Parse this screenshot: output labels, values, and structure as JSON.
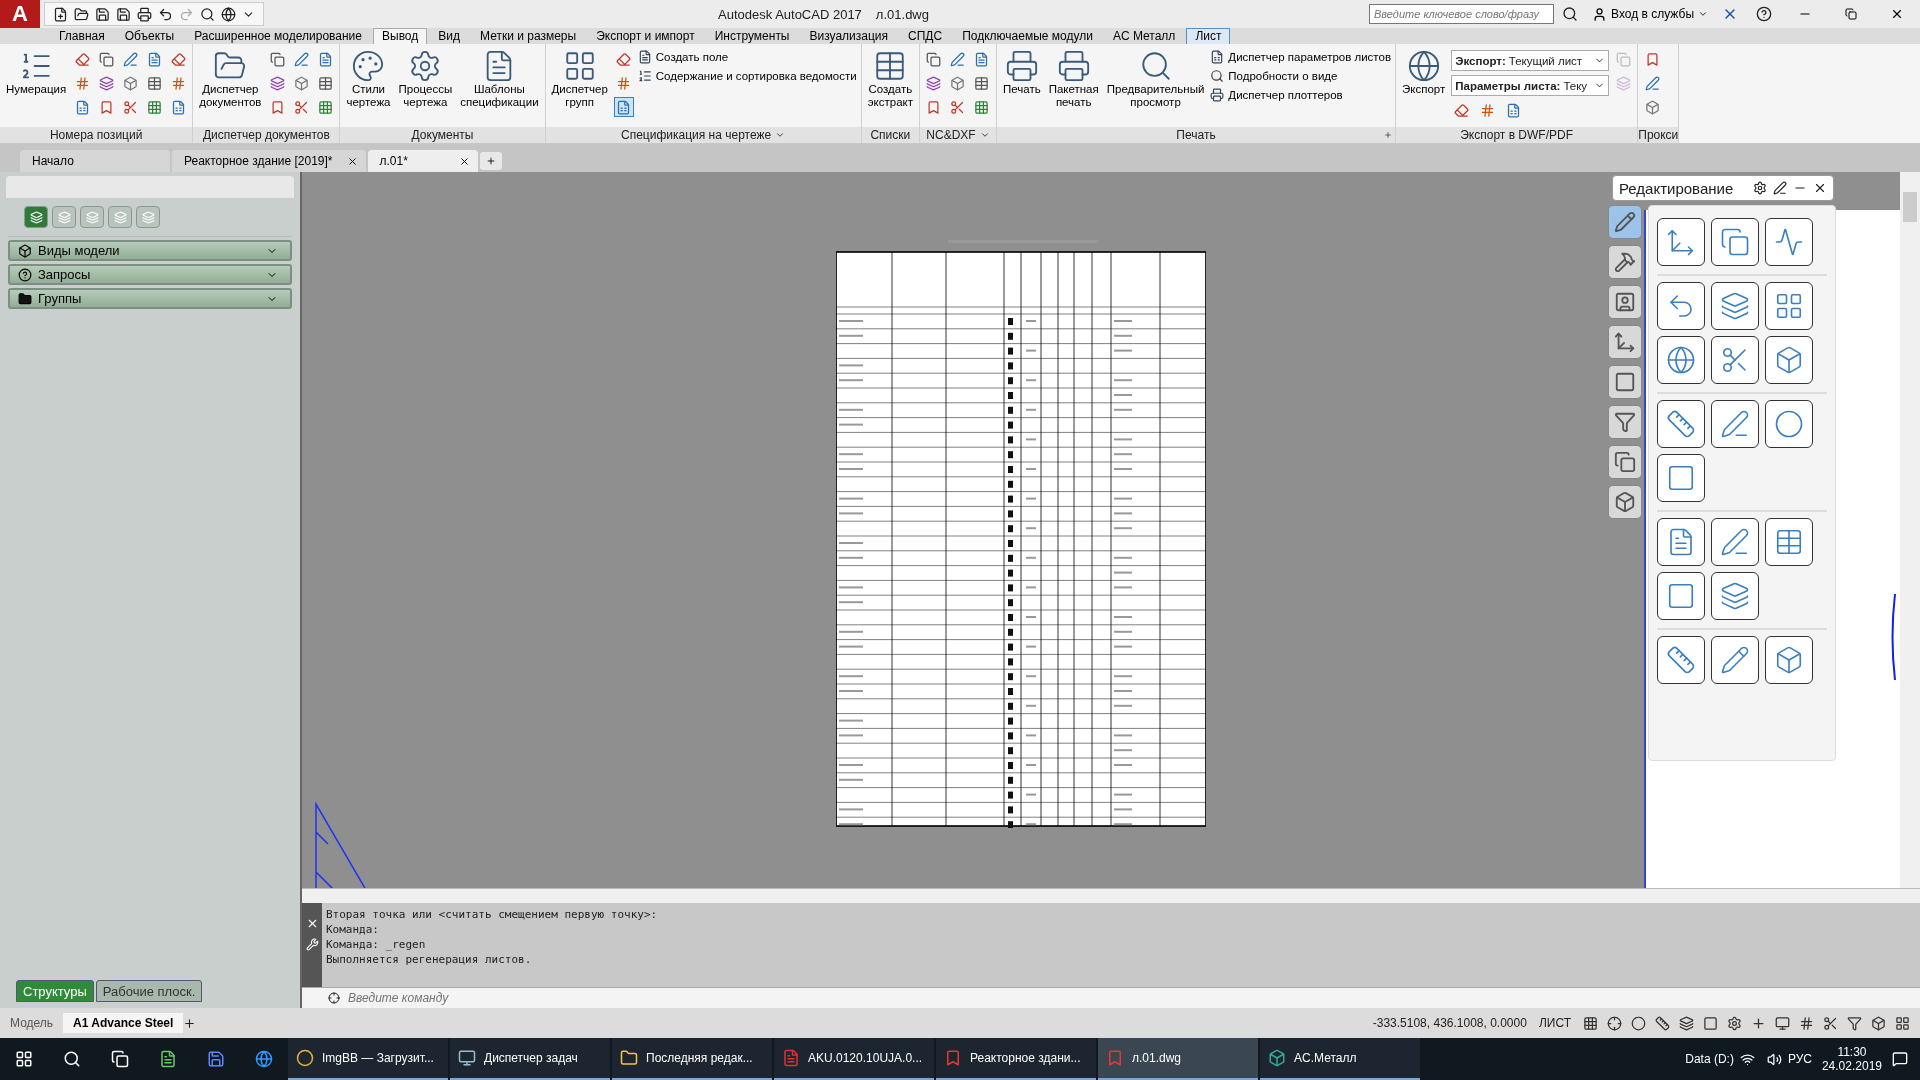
{
  "app_menu": {
    "letter": "A"
  },
  "window": {
    "title": "Autodesk AutoCAD 2017",
    "file": "л.01.dwg"
  },
  "search": {
    "placeholder": "Введите ключевое слово/фразу"
  },
  "sign_in": {
    "label": "Вход в службы"
  },
  "ribbon_tabs": [
    {
      "label": "Главная",
      "selected": false,
      "outlined": false
    },
    {
      "label": "Объекты",
      "selected": false,
      "outlined": false
    },
    {
      "label": "Расширенное моделирование",
      "selected": false,
      "outlined": false
    },
    {
      "label": "Вывод",
      "selected": true,
      "outlined": false
    },
    {
      "label": "Вид",
      "selected": false,
      "outlined": false
    },
    {
      "label": "Метки и размеры",
      "selected": false,
      "outlined": false
    },
    {
      "label": "Экспорт и импорт",
      "selected": false,
      "outlined": false
    },
    {
      "label": "Инструменты",
      "selected": false,
      "outlined": false
    },
    {
      "label": "Визуализация",
      "selected": false,
      "outlined": false
    },
    {
      "label": "СПДС",
      "selected": false,
      "outlined": false
    },
    {
      "label": "Подключаемые модули",
      "selected": false,
      "outlined": false
    },
    {
      "label": "AC Металл",
      "selected": false,
      "outlined": false
    },
    {
      "label": "Лист",
      "selected": false,
      "outlined": true
    }
  ],
  "ribbon_groups": [
    {
      "label": "Номера позиций",
      "has_menu": false,
      "launcher": false,
      "items": [
        {
          "kind": "large",
          "label": "Нумерация"
        },
        {
          "kind": "icon",
          "selected": false,
          "disabled": false
        },
        {
          "kind": "icon",
          "selected": false,
          "disabled": false
        },
        {
          "kind": "icon",
          "selected": false,
          "disabled": false
        },
        {
          "kind": "icon",
          "selected": false,
          "disabled": false
        },
        {
          "kind": "icon",
          "selected": false,
          "disabled": false
        },
        {
          "kind": "icon",
          "selected": false,
          "disabled": false
        },
        {
          "kind": "icon",
          "selected": false,
          "disabled": false
        },
        {
          "kind": "icon",
          "selected": false,
          "disabled": false
        },
        {
          "kind": "icon",
          "selected": false,
          "disabled": false
        },
        {
          "kind": "icon",
          "selected": false,
          "disabled": false
        },
        {
          "kind": "icon",
          "selected": false,
          "disabled": false
        },
        {
          "kind": "icon",
          "selected": false,
          "disabled": false
        },
        {
          "kind": "icon",
          "selected": false,
          "disabled": false
        },
        {
          "kind": "icon",
          "selected": false,
          "disabled": false
        },
        {
          "kind": "icon",
          "selected": false,
          "disabled": false
        }
      ]
    },
    {
      "label": "Диспетчер документов",
      "has_menu": false,
      "launcher": false,
      "items": [
        {
          "kind": "large",
          "label": "Диспетчер документов"
        },
        {
          "kind": "icon",
          "selected": false,
          "disabled": false
        },
        {
          "kind": "icon",
          "selected": false,
          "disabled": false
        },
        {
          "kind": "icon",
          "selected": false,
          "disabled": false
        },
        {
          "kind": "icon",
          "selected": false,
          "disabled": false
        },
        {
          "kind": "icon",
          "selected": false,
          "disabled": false
        },
        {
          "kind": "icon",
          "selected": false,
          "disabled": false
        },
        {
          "kind": "icon",
          "selected": false,
          "disabled": false
        },
        {
          "kind": "icon",
          "selected": false,
          "disabled": false
        },
        {
          "kind": "icon",
          "selected": false,
          "disabled": false
        }
      ]
    },
    {
      "label": "Документы",
      "has_menu": false,
      "launcher": false,
      "items": [
        {
          "kind": "large",
          "label": "Стили чертежа"
        },
        {
          "kind": "large",
          "label": "Процессы чертежа"
        },
        {
          "kind": "large",
          "label": "Шаблоны спецификации"
        }
      ]
    },
    {
      "label": "Спецификация на чертеже",
      "has_menu": true,
      "launcher": false,
      "items": [
        {
          "kind": "large",
          "label": "Диспетчер групп"
        },
        {
          "kind": "icon",
          "selected": false,
          "disabled": false
        },
        {
          "kind": "icon",
          "selected": false,
          "disabled": false
        },
        {
          "kind": "icon",
          "selected": true,
          "disabled": false
        },
        {
          "kind": "text",
          "label": "Создать поле"
        },
        {
          "kind": "text",
          "label": "Содержание и сортировка ведомости"
        }
      ]
    },
    {
      "label": "Списки",
      "has_menu": false,
      "launcher": false,
      "items": [
        {
          "kind": "large",
          "label": "Создать экстракт"
        }
      ]
    },
    {
      "label": "NC&DXF",
      "has_menu": true,
      "launcher": false,
      "items": [
        {
          "kind": "icon",
          "selected": false,
          "disabled": false
        },
        {
          "kind": "icon",
          "selected": false,
          "disabled": false
        },
        {
          "kind": "icon",
          "selected": false,
          "disabled": false
        },
        {
          "kind": "icon",
          "selected": false,
          "disabled": false
        },
        {
          "kind": "icon",
          "selected": false,
          "disabled": false
        },
        {
          "kind": "icon",
          "selected": false,
          "disabled": false
        },
        {
          "kind": "icon",
          "selected": false,
          "disabled": false
        },
        {
          "kind": "icon",
          "selected": false,
          "disabled": false
        },
        {
          "kind": "icon",
          "selected": false,
          "disabled": false
        }
      ]
    },
    {
      "label": "Печать",
      "has_menu": false,
      "launcher": true,
      "items": [
        {
          "kind": "large",
          "label": "Печать"
        },
        {
          "kind": "large",
          "label": "Пакетная печать"
        },
        {
          "kind": "large",
          "label": "Предварительный просмотр"
        },
        {
          "kind": "text",
          "label": "Диспетчер параметров листов"
        },
        {
          "kind": "text",
          "label": "Подробности о виде"
        },
        {
          "kind": "text",
          "label": "Диспетчер плоттеров"
        }
      ]
    },
    {
      "label": "Экспорт в DWF/PDF",
      "has_menu": false,
      "launcher": false,
      "items": [
        {
          "kind": "large",
          "label": "Экспорт"
        },
        {
          "kind": "dropdown",
          "label": "Экспорт:",
          "value": "Текущий лист"
        },
        {
          "kind": "dropdown",
          "label": "Параметры листа:",
          "value": "Теку"
        },
        {
          "kind": "icon",
          "selected": false,
          "disabled": false
        },
        {
          "kind": "icon",
          "selected": false,
          "disabled": false
        },
        {
          "kind": "icon",
          "selected": false,
          "disabled": false
        },
        {
          "kind": "icon",
          "selected": false,
          "disabled": true
        },
        {
          "kind": "icon",
          "selected": false,
          "disabled": true
        }
      ]
    },
    {
      "label": "Прокси",
      "has_menu": false,
      "launcher": false,
      "items": [
        {
          "kind": "icon",
          "selected": false,
          "disabled": false
        },
        {
          "kind": "icon",
          "selected": false,
          "disabled": false
        },
        {
          "kind": "icon",
          "selected": false,
          "disabled": false
        }
      ]
    }
  ],
  "doc_tabs": [
    {
      "label": "Начало",
      "selected": false,
      "closable": false
    },
    {
      "label": "Реакторное здание [2019]*",
      "selected": false,
      "closable": true
    },
    {
      "label": "л.01*",
      "selected": true,
      "closable": true
    }
  ],
  "left_panel": {
    "tools": [
      {
        "selected": true
      },
      {
        "selected": false
      },
      {
        "selected": false
      },
      {
        "selected": false
      },
      {
        "selected": false
      }
    ],
    "sections": [
      {
        "kind": "views",
        "label": "Виды модели"
      },
      {
        "kind": "queries",
        "label": "Запросы"
      },
      {
        "kind": "groups",
        "label": "Группы"
      }
    ],
    "tabs": [
      {
        "label": "Структуры",
        "selected": true
      },
      {
        "label": "Рабочие плоск.",
        "selected": false
      }
    ]
  },
  "palette": {
    "title": "Редактирование",
    "side_tabs": [
      {
        "selected": true
      },
      {
        "selected": false
      },
      {
        "selected": false
      },
      {
        "selected": false
      },
      {
        "selected": false
      },
      {
        "selected": false
      },
      {
        "selected": false
      },
      {
        "selected": false
      }
    ]
  },
  "command": {
    "history": [
      "Вторая точка или <считать смещением первую точку>:",
      "Команда:",
      "Команда: _regen",
      "Выполняется регенерация листов."
    ],
    "placeholder": "Введите команду"
  },
  "layout_tabs": [
    {
      "label": "Модель",
      "selected": false
    },
    {
      "label": "A1 Advance Steel",
      "selected": true
    }
  ],
  "status": {
    "coordinates": "-333.5108, 436.1008, 0.0000",
    "space": "ЛИСТ"
  },
  "taskbar": {
    "items": [
      {
        "kind": "chrome",
        "label": "ImgBB — Загрузит...",
        "selected": false
      },
      {
        "kind": "taskmgr",
        "label": "Диспетчер задач",
        "selected": false
      },
      {
        "kind": "folder",
        "label": "Последняя редак...",
        "selected": false
      },
      {
        "kind": "pdf",
        "label": "AKU.0120.10UJA.0...",
        "selected": false
      },
      {
        "kind": "autocad",
        "label": "Реакторное здани...",
        "selected": false
      },
      {
        "kind": "autocad",
        "label": "л.01.dwg",
        "selected": true
      },
      {
        "kind": "acmetal",
        "label": "AC.Металл",
        "selected": false
      }
    ],
    "drive": "Data (D:)",
    "language": "РУС",
    "time": "11:30",
    "date": "24.02.2019"
  }
}
